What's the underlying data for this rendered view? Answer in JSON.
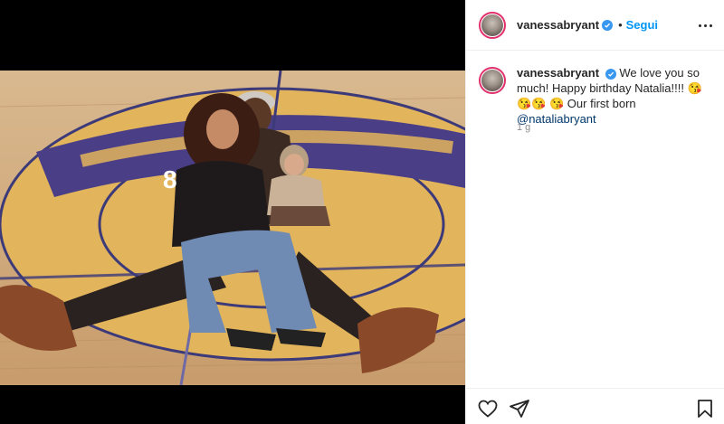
{
  "post": {
    "account": {
      "username": "vanessabryant",
      "verified_color": "#3897f0",
      "separator": "•",
      "follow_label": "Segui"
    },
    "caption": {
      "username": "vanessabryant",
      "text_1": "We love you so much! Happy birthday Natalia!!!! ",
      "emojis_1": "😘😘😘",
      "emojis_2": "😘",
      "text_2": " Our first born ",
      "mention": "@nataliabryant"
    },
    "timestamp": "1 g",
    "icons": {
      "more": "more-options-icon",
      "like": "heart-icon",
      "share": "send-icon",
      "save": "bookmark-icon"
    },
    "colors": {
      "link_blue": "#0095f6",
      "mention": "#00376b",
      "muted": "#8e8e8e"
    }
  }
}
